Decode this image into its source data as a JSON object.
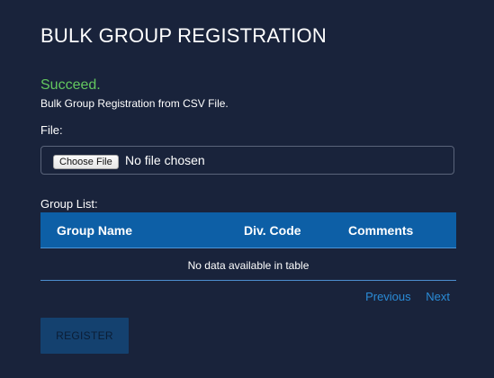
{
  "page": {
    "title": "BULK GROUP REGISTRATION"
  },
  "status": {
    "headline": "Succeed.",
    "message": "Bulk Group Registration from CSV File."
  },
  "file": {
    "label": "File:",
    "button_label": "Choose File",
    "status_text": "No file chosen"
  },
  "group_list": {
    "label": "Group List:",
    "columns": [
      "Group Name",
      "Div. Code",
      "Comments"
    ],
    "empty_message": "No data available in table",
    "pagination": {
      "previous_label": "Previous",
      "next_label": "Next"
    }
  },
  "actions": {
    "register_label": "REGISTER"
  },
  "colors": {
    "background": "#19233b",
    "success": "#63c75f",
    "table_header": "#0d5fa6",
    "link": "#2a8bd6",
    "button_disabled": "#14416f"
  }
}
